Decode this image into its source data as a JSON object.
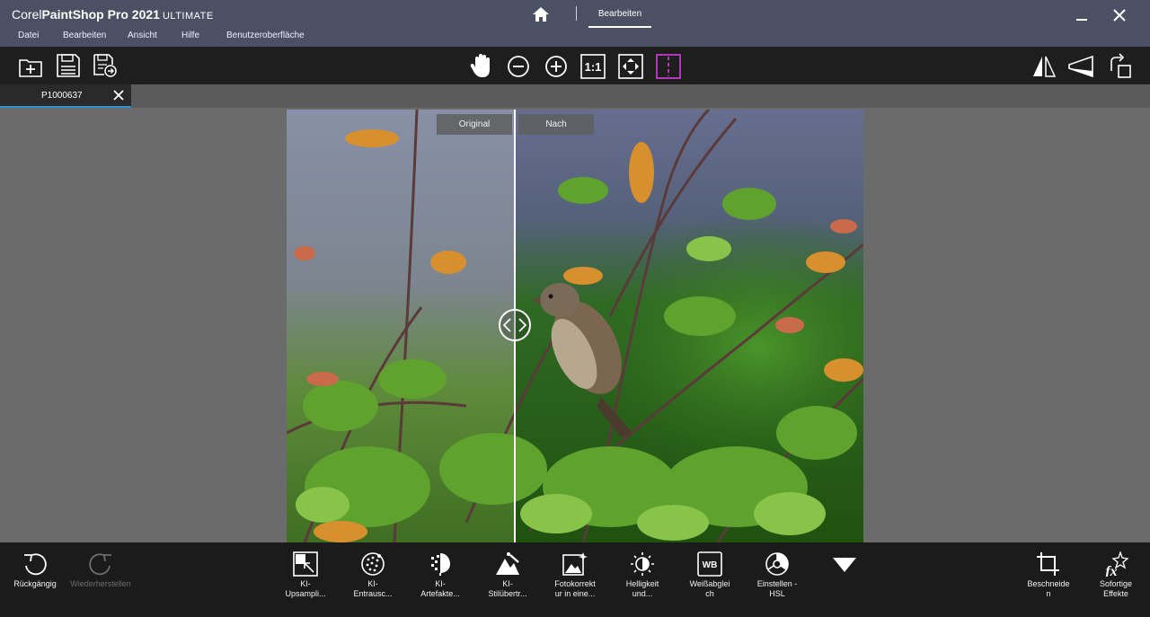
{
  "app": {
    "brand_corel": "Corel",
    "brand_name": "PaintShop Pro 2021",
    "brand_edition": "ULTIMATE",
    "tab_label": "Bearbeiten"
  },
  "menu": [
    "Datei",
    "Bearbeiten",
    "Ansicht",
    "Hilfe",
    "Benutzeroberfläche"
  ],
  "toolbar": {
    "left": [
      "new-folder-icon",
      "save-icon",
      "save-as-icon"
    ],
    "center": [
      "pan-hand-icon",
      "zoom-out-icon",
      "zoom-in-icon",
      "actual-size-icon",
      "fit-to-window-icon",
      "split-compare-icon"
    ],
    "right": [
      "flip-icon",
      "perspective-icon",
      "rotate-icon"
    ],
    "zoom_actual_label": "1:1"
  },
  "document": {
    "tab_name": "P1000637"
  },
  "compare": {
    "before_label": "Original",
    "after_label": "Nach"
  },
  "bottom": {
    "undo": "Rückgängig",
    "redo": "Wiederherstellen",
    "tools": [
      {
        "label": "KI-\nUpsampli..."
      },
      {
        "label": "KI-\nEntrausc..."
      },
      {
        "label": "KI-\nArtefakte..."
      },
      {
        "label": "KI-\nStilübertr..."
      },
      {
        "label": "Fotokorrekt\nur in eine..."
      },
      {
        "label": "Helligkeit\nund..."
      },
      {
        "label": "Weißabglei\nch"
      },
      {
        "label": "Einstellen -\nHSL"
      }
    ],
    "crop": "Beschneide\nn",
    "effects": "Sofortige\nEffekte",
    "wb_badge": "WB",
    "fx_badge": "fx"
  },
  "colors": {
    "title_bg": "#4b5065",
    "accent_split": "#c03cc8",
    "tab_underline": "#2f8fd6"
  }
}
